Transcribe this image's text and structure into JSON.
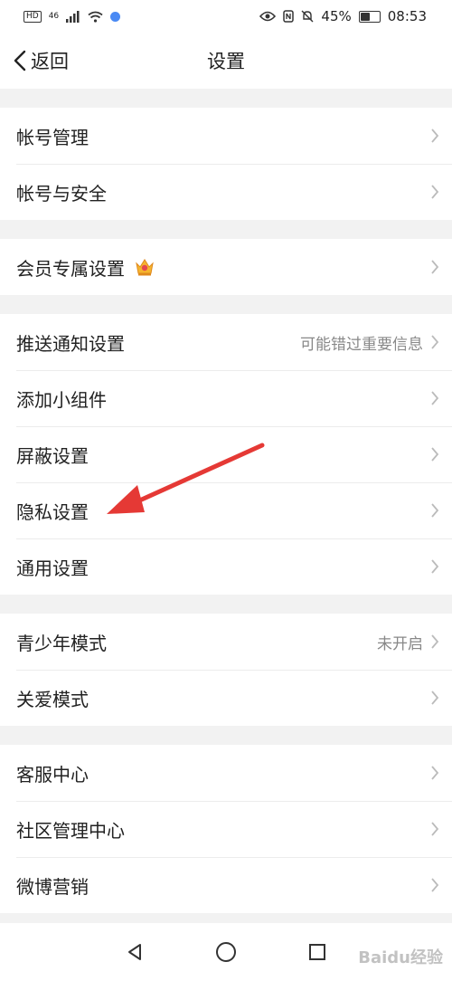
{
  "status_bar": {
    "hd": "HD",
    "network": "46",
    "battery_pct": "45%",
    "battery_level": 0.45,
    "time": "08:53"
  },
  "navbar": {
    "back_label": "返回",
    "title": "设置"
  },
  "groups": [
    {
      "items": [
        {
          "label": "帐号管理"
        },
        {
          "label": "帐号与安全"
        }
      ]
    },
    {
      "items": [
        {
          "label": "会员专属设置",
          "icon": "crown-icon"
        }
      ]
    },
    {
      "items": [
        {
          "label": "推送通知设置",
          "value": "可能错过重要信息"
        },
        {
          "label": "添加小组件"
        },
        {
          "label": "屏蔽设置"
        },
        {
          "label": "隐私设置"
        },
        {
          "label": "通用设置"
        }
      ]
    },
    {
      "items": [
        {
          "label": "青少年模式",
          "value": "未开启"
        },
        {
          "label": "关爱模式"
        }
      ]
    },
    {
      "items": [
        {
          "label": "客服中心"
        },
        {
          "label": "社区管理中心"
        },
        {
          "label": "微博营销"
        }
      ]
    }
  ],
  "annotation": {
    "color": "#e53935"
  },
  "watermark": "Baidu经验"
}
